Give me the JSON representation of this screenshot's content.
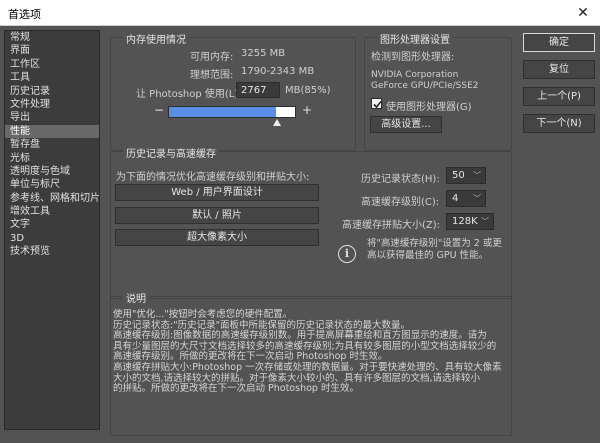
{
  "window": {
    "title": "首选项",
    "close": "✕"
  },
  "sidebar": {
    "items": [
      {
        "label": "常规"
      },
      {
        "label": "界面"
      },
      {
        "label": "工作区"
      },
      {
        "label": "工具"
      },
      {
        "label": "历史记录"
      },
      {
        "label": "文件处理"
      },
      {
        "label": "导出"
      },
      {
        "label": "性能"
      },
      {
        "label": "暂存盘"
      },
      {
        "label": "光标"
      },
      {
        "label": "透明度与色域"
      },
      {
        "label": "单位与标尺"
      },
      {
        "label": "参考线、网格和切片"
      },
      {
        "label": "增效工具"
      },
      {
        "label": "文字"
      },
      {
        "label": "3D"
      },
      {
        "label": "技术预览"
      }
    ],
    "selected": "性能"
  },
  "memory": {
    "title": "内存使用情况",
    "available_label": "可用内存:",
    "available_value": "3255 MB",
    "ideal_label": "理想范围:",
    "ideal_value": "1790-2343 MB",
    "let_label": "让 Photoshop 使用(L):",
    "let_value": "2767",
    "let_unit": "MB(85%)",
    "percent": 85,
    "minus": "−",
    "plus": "+"
  },
  "gpu": {
    "title": "图形处理器设置",
    "detected_label": "检测到图形处理器:",
    "vendor": "NVIDIA Corporation",
    "model": "GeForce GPU/PCIe/SSE2",
    "use_gpu_label": "使用图形处理器(G)",
    "use_gpu_checked": true,
    "advanced_button": "高级设置..."
  },
  "history_cache": {
    "title": "历史记录与高速缓存",
    "hint": "为下面的情况优化高速缓存级别和拼贴大小:",
    "preset_web": "Web / 用户界面设计",
    "preset_default": "默认 / 照片",
    "preset_huge": "超大像素大小",
    "history_states_label": "历史记录状态(H):",
    "history_states_value": "50",
    "cache_levels_label": "高速缓存级别(C):",
    "cache_levels_value": "4",
    "tile_size_label": "高速缓存拼贴大小(Z):",
    "tile_size_value": "128K",
    "info_line1": "将\"高速缓存级别\"设置为 2 或更",
    "info_line2": "高以获得最佳的 GPU 性能。"
  },
  "description": {
    "title": "说明",
    "lines": [
      "使用\"优化...\"按钮时会考虑您的硬件配置。",
      "历史记录状态:\"历史记录\"面板中所能保留的历史记录状态的最大数量。",
      "高速缓存级别:图像数据的高速缓存级别数。用于提高屏幕重绘和直方图显示的速度。请为",
      "具有少量图层的大尺寸文档选择较多的高速缓存级别;为具有较多图层的小型文档选择较少的",
      "高速缓存级别。所做的更改将在下一次启动 Photoshop 时生效。",
      "高速缓存拼贴大小:Photoshop 一次存储或处理的数据量。对于要快速处理的、具有较大像素",
      "大小的文档,请选择较大的拼贴。对于像素大小较小的、具有许多图层的文档,请选择较小",
      "的拼贴。所做的更改将在下一次启动 Photoshop 时生效。"
    ]
  },
  "actions": {
    "ok": "确定",
    "reset": "复位",
    "prev": "上一个(P)",
    "next": "下一个(N)"
  }
}
